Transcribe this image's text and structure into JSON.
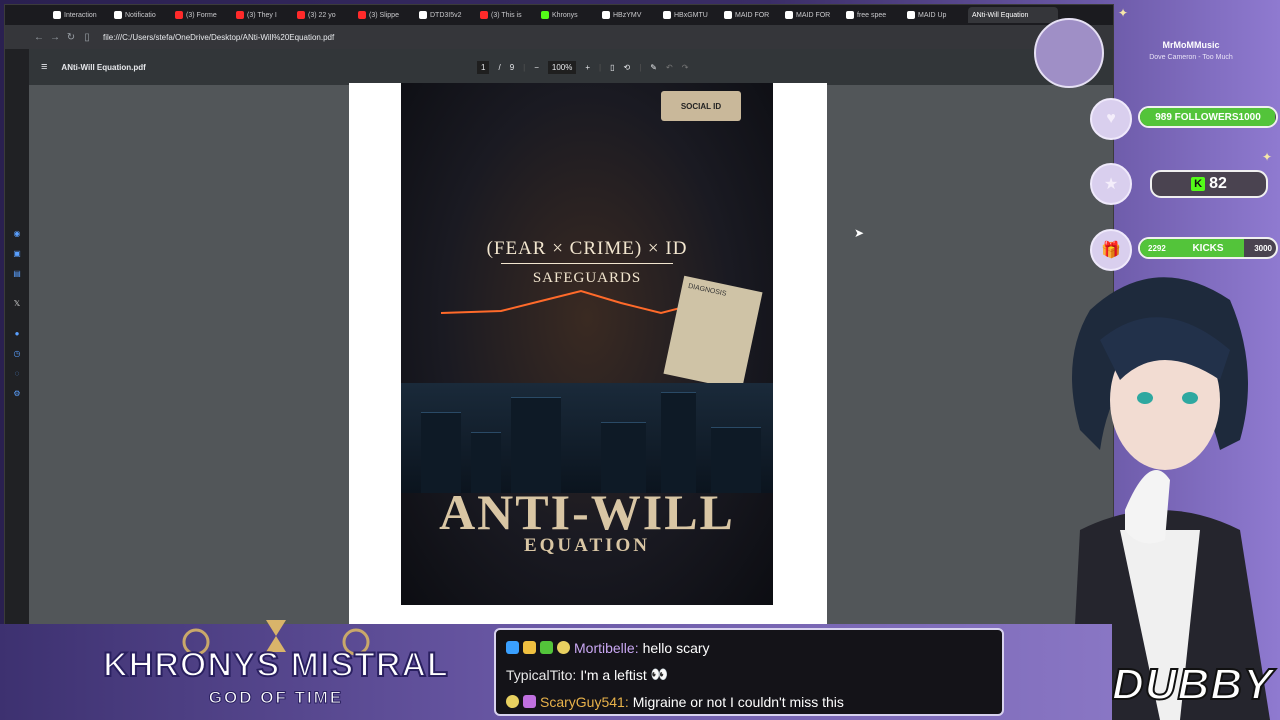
{
  "browser": {
    "tabs": [
      {
        "label": "Interaction",
        "color": "#ffffff"
      },
      {
        "label": "Notificatio",
        "color": "#ffffff"
      },
      {
        "label": "(3) Forme",
        "color": "#ff2a2a"
      },
      {
        "label": "(3) They I",
        "color": "#ff2a2a"
      },
      {
        "label": "(3) 22 yo",
        "color": "#ff2a2a"
      },
      {
        "label": "(3) Slippe",
        "color": "#ff2a2a"
      },
      {
        "label": "DTD3I5v2",
        "color": "#ffffff"
      },
      {
        "label": "(3) This is",
        "color": "#ff2a2a"
      },
      {
        "label": "Khronys",
        "color": "#53fc18"
      },
      {
        "label": "HBzYMV",
        "color": "#ffffff"
      },
      {
        "label": "HBxGMTU",
        "color": "#ffffff"
      },
      {
        "label": "MAID FOR",
        "color": "#ffffff"
      },
      {
        "label": "MAID FOR",
        "color": "#ffffff"
      },
      {
        "label": "free spee",
        "color": "#ffffff"
      },
      {
        "label": "MAID Up",
        "color": "#ffffff"
      }
    ],
    "active_tab": "ANti-Will Equation",
    "url": "file:///C:/Users/stefa/OneDrive/Desktop/ANti-Will%20Equation.pdf"
  },
  "pdf": {
    "filename": "ANti-Will Equation.pdf",
    "page_current": "1",
    "page_sep": "/",
    "page_total": "9",
    "zoom": "100%"
  },
  "cover": {
    "social_id": "SOCIAL ID",
    "formula": "(FEAR × CRIME) × ID",
    "safeguards": "SAFEGUARDS",
    "diagnosis": "DIAGNOSIS",
    "title": "ANTI-WILL",
    "subtitle": "EQUATION"
  },
  "now_playing": {
    "artist": "MrMoMMusic",
    "track": "Dove Cameron - Too Much"
  },
  "goals": {
    "followers_text": "989 FOLLOWERS1000",
    "followers_progress": 0.989,
    "kick_count": "82",
    "kicks_current": "2292",
    "kicks_label": "KICKS",
    "kicks_target": "3000",
    "kicks_progress": 0.764
  },
  "branding": {
    "logo_main": "KHRONYS MISTRAL",
    "logo_sub": "GOD OF TIME",
    "dubby": "DUBBY"
  },
  "chat": [
    {
      "user": "Mortibelle:",
      "user_color": "#c9a7f2",
      "message": "hello scary"
    },
    {
      "user": "TypicalTito:",
      "user_color": "#e8e8e8",
      "message": "I'm a leftist"
    },
    {
      "user": "ScaryGuy541:",
      "user_color": "#e8b24a",
      "message": "Migraine or not I couldn't miss this"
    }
  ]
}
